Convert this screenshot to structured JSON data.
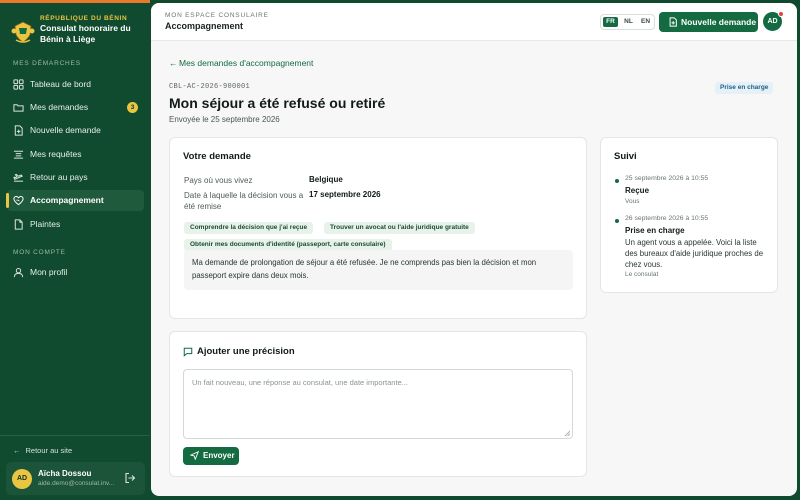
{
  "brand": {
    "republic": "RÉPUBLIQUE DU BÉNIN",
    "consulate": "Consulat honoraire du Bénin à Liège"
  },
  "sidebar": {
    "section_demarches": "MES DÉMARCHES",
    "section_compte": "MON COMPTE",
    "items": [
      {
        "label": "Tableau de bord",
        "icon": "grid-icon"
      },
      {
        "label": "Mes demandes",
        "icon": "folder-icon",
        "badge": "3"
      },
      {
        "label": "Nouvelle demande",
        "icon": "file-plus-icon"
      },
      {
        "label": "Mes requêtes",
        "icon": "list-icon"
      },
      {
        "label": "Retour au pays",
        "icon": "plane-icon"
      },
      {
        "label": "Accompagnement",
        "icon": "heart-hand-icon",
        "active": true
      },
      {
        "label": "Plaintes",
        "icon": "document-icon"
      }
    ],
    "profile": {
      "label": "Mon profil",
      "icon": "user-icon"
    },
    "back_to_site": "Retour au site",
    "user": {
      "initials": "AD",
      "name": "Aïcha Dossou",
      "email": "aide.demo@consulat.inv..."
    }
  },
  "header": {
    "subtitle": "MON ESPACE CONSULAIRE",
    "title": "Accompagnement",
    "languages": [
      "FR",
      "NL",
      "EN"
    ],
    "active_language": "FR",
    "new_request_label": "Nouvelle demande",
    "avatar_initials": "AD"
  },
  "page": {
    "back_label": "Mes demandes d'accompagnement",
    "reference": "CBL-AC-2026-900001",
    "status": "Prise en charge",
    "title": "Mon séjour a été refusé ou retiré",
    "sent": "Envoyée le 25 septembre 2026"
  },
  "request": {
    "title": "Votre demande",
    "rows": [
      {
        "key": "Pays où vous vivez",
        "value": "Belgique"
      },
      {
        "key": "Date à laquelle la décision vous a été remise",
        "value": "17 septembre 2026"
      }
    ],
    "tags": [
      "Comprendre la décision que j'ai reçue",
      "Trouver un avocat ou l'aide juridique gratuite",
      "Obtenir mes documents d'identité (passeport, carte consulaire)"
    ],
    "message": "Ma demande de prolongation de séjour a été refusée. Je ne comprends pas bien la décision et mon passeport expire dans deux mois."
  },
  "followup": {
    "title": "Suivi",
    "events": [
      {
        "date": "25 septembre 2026 à 10:55",
        "title": "Reçue",
        "text": "",
        "by": "Vous"
      },
      {
        "date": "26 septembre 2026 à 10:55",
        "title": "Prise en charge",
        "text": "Un agent vous a appelée. Voici la liste des bureaux d'aide juridique proches de chez vous.",
        "by": "Le consulat"
      }
    ]
  },
  "precision": {
    "title": "Ajouter une précision",
    "placeholder": "Un fait nouveau, une réponse au consulat, une date importante...",
    "send_label": "Envoyer"
  },
  "colors": {
    "sidebar": "#104a2f",
    "accent": "#146b42",
    "gold": "#e9c542",
    "orange": "#e8782a"
  }
}
